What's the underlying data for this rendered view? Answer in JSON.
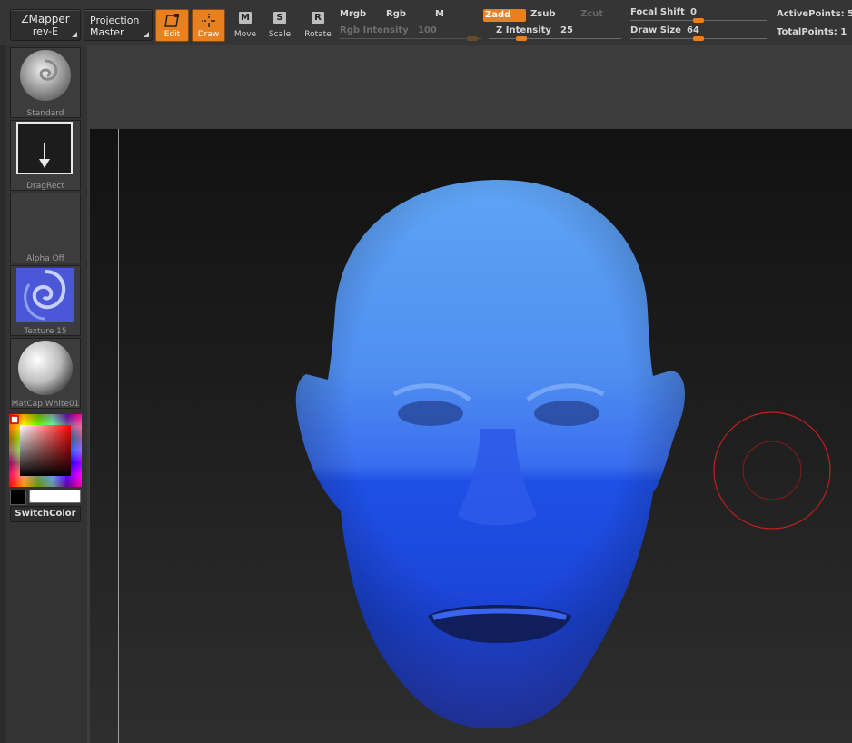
{
  "toolbar": {
    "zmapper_line1": "ZMapper",
    "zmapper_line2": "rev-E",
    "projection_line1": "Projection",
    "projection_line2": "Master",
    "edit_label": "Edit",
    "draw_label": "Draw",
    "move_label": "Move",
    "scale_label": "Scale",
    "rotate_label": "Rotate",
    "move_glyph": "M",
    "scale_glyph": "S",
    "rotate_glyph": "R",
    "mrgb_label": "Mrgb",
    "rgb_label": "Rgb",
    "m_label": "M",
    "rgb_intensity_label": "Rgb  Intensity",
    "rgb_intensity_value": "100",
    "zadd_label": "Zadd",
    "zsub_label": "Zsub",
    "zcut_label": "Zcut",
    "z_intensity_label": "Z  Intensity",
    "z_intensity_value": "25",
    "focal_shift_label": "Focal  Shift",
    "focal_shift_value": "0",
    "draw_size_label": "Draw  Size",
    "draw_size_value": "64",
    "active_points_label": "ActivePoints:",
    "active_points_value": "5",
    "total_points_label": "TotalPoints:",
    "total_points_value": "1"
  },
  "shelf": {
    "brush_label": "Standard",
    "stroke_label": "DragRect",
    "alpha_label": "Alpha  Off",
    "texture_label": "Texture  15",
    "material_label": "MatCap  White01",
    "switch_color_label": "SwitchColor"
  },
  "colors": {
    "accent": "#e8801f",
    "head_light_blue": "#5a9af0",
    "head_deep_blue": "#1f4fe8",
    "brush_ring": "#c0201f"
  },
  "icons": {
    "zmapper": "dropdown-corner-icon",
    "projection": "dropdown-corner-icon",
    "edit": "edit-frame-icon",
    "draw": "draw-crosshair-icon"
  }
}
